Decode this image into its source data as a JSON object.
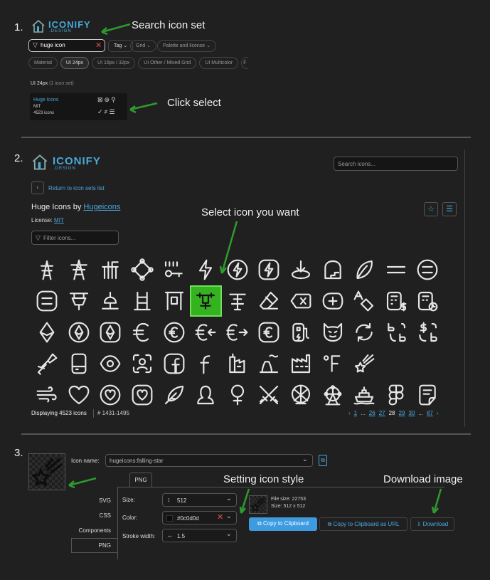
{
  "steps": {
    "s1_num": "1.",
    "s2_num": "2.",
    "s3_num": "3.",
    "annotation_search": "Search icon set",
    "annotation_click": "Click select",
    "annotation_select": "Select icon you want",
    "annotation_style": "Setting icon style",
    "annotation_download": "Download image"
  },
  "logo": {
    "text": "ICONIFY",
    "sub": ".DESIGN"
  },
  "step1": {
    "search_value": "huge icon",
    "tag_label": "Tag",
    "grid_label": "Grid",
    "palette_label": "Palette and license",
    "filters": [
      "Material",
      "UI 24px",
      "UI 16px / 32px",
      "UI Other / Mixed Grid",
      "UI Multicolor",
      "F"
    ],
    "active_filter": "UI 24px",
    "section_title": "UI 24px",
    "section_count": "(1 icon set)",
    "card_name": "Huge Icons",
    "card_license": "MIT",
    "card_count": "4523 icons"
  },
  "step2": {
    "search_placeholder": "Search icons...",
    "back_label": "Return to icon sets list",
    "title_prefix": "Huge Icons by",
    "title_author": "Hugeicons",
    "license_label": "License:",
    "license_value": "MIT",
    "filter_placeholder": "Filter icons...",
    "displaying": "Displaying 4523 icons",
    "range": "# 1431-1495",
    "pages": [
      "1",
      "...",
      "26",
      "27",
      "28",
      "29",
      "30",
      "...",
      "87"
    ],
    "current_page": "28"
  },
  "step3": {
    "icon_name_label": "Icon name:",
    "icon_name_value": "hugeicons:falling-star",
    "tab_png": "PNG",
    "side_tabs": [
      "SVG",
      "CSS",
      "Components",
      "PNG"
    ],
    "size_label": "Size:",
    "size_value": "512",
    "color_label": "Color:",
    "color_value": "#0c0d0d",
    "stroke_label": "Stroke width:",
    "stroke_value": "1.5",
    "file_size": "File size: 22753",
    "dims": "Size: 512 x 512",
    "copy_btn": "Copy to Clipboard",
    "copy_url_btn": "Copy to Clipboard as URL",
    "download_btn": "Download"
  },
  "colors": {
    "accent": "#3d9be0",
    "select_green": "#35b21f",
    "arrow_green": "#2e9b2e"
  }
}
